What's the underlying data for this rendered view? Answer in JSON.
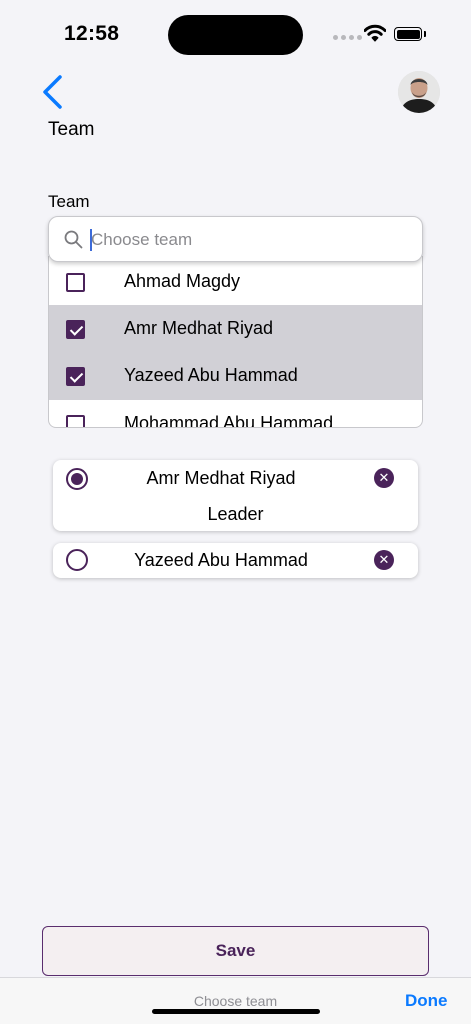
{
  "status_bar": {
    "time": "12:58"
  },
  "nav": {
    "title": "Team"
  },
  "form": {
    "team_label": "Team",
    "search": {
      "placeholder": "Choose team",
      "value": ""
    }
  },
  "dropdown_options": [
    {
      "label": "Ahmad Magdy",
      "checked": false
    },
    {
      "label": "Amr Medhat Riyad",
      "checked": true
    },
    {
      "label": "Yazeed Abu Hammad",
      "checked": true
    },
    {
      "label": "Mohammad Abu Hammad",
      "checked": false
    }
  ],
  "selected_members": [
    {
      "name": "Amr Medhat Riyad",
      "role": "Leader",
      "is_leader": true
    },
    {
      "name": "Yazeed Abu Hammad",
      "role": "",
      "is_leader": false
    }
  ],
  "actions": {
    "save_label": "Save"
  },
  "keyboard_accessory": {
    "title": "Choose team",
    "done_label": "Done"
  },
  "colors": {
    "accent": "#4a235a",
    "link": "#0a7aff",
    "selected_row": "#d1d0d6"
  }
}
